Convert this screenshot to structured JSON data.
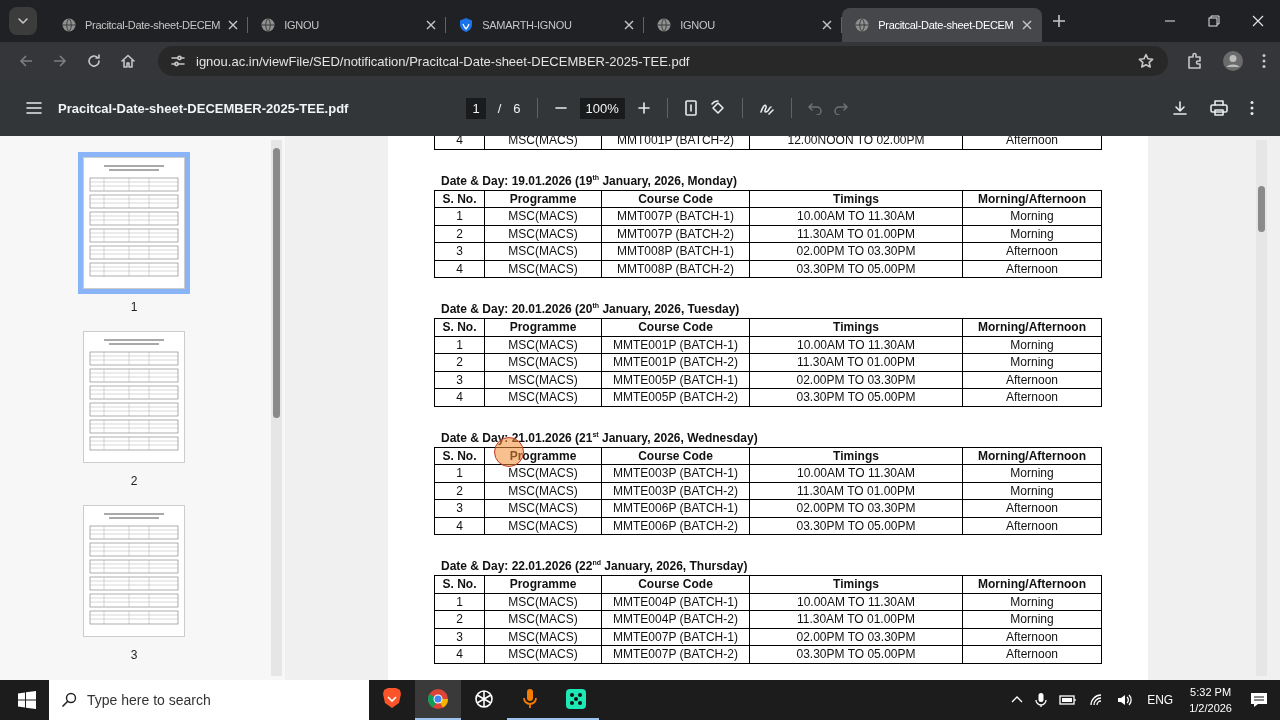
{
  "browser": {
    "tabs": [
      {
        "title": "Pracitcal-Date-sheet-DECEM",
        "kind": "globe",
        "selected": false
      },
      {
        "title": "IGNOU",
        "kind": "globe",
        "selected": false
      },
      {
        "title": "SAMARTH-IGNOU",
        "kind": "shield",
        "selected": false
      },
      {
        "title": "IGNOU",
        "kind": "globe",
        "selected": false
      },
      {
        "title": "Pracitcal-Date-sheet-DECEM",
        "kind": "globe",
        "selected": true
      }
    ],
    "url": "ignou.ac.in/viewFile/SED/notification/Pracitcal-Date-sheet-DECEMBER-2025-TEE.pdf"
  },
  "pdf_toolbar": {
    "file_name": "Pracitcal-Date-sheet-DECEMBER-2025-TEE.pdf",
    "page": "1",
    "page_separator": "/",
    "page_count": "6",
    "zoom": "100%"
  },
  "thumbnails": [
    {
      "label": "1",
      "selected": true
    },
    {
      "label": "2",
      "selected": false
    },
    {
      "label": "3",
      "selected": false
    }
  ],
  "document": {
    "partial_row": [
      "4",
      "MSC(MACS)",
      "MMT001P (BATCH-2)",
      "12.00NOON TO 02.00PM",
      "Afternoon"
    ],
    "sections": [
      {
        "heading": "Date & Day: 19.01.2026 (19$^{th}$ January, 2026, Monday)",
        "columns": [
          "S. No.",
          "Programme",
          "Course Code",
          "Timings",
          "Morning/Afternoon"
        ],
        "rows": [
          [
            "1",
            "MSC(MACS)",
            "MMT007P (BATCH-1)",
            "10.00AM TO 11.30AM",
            "Morning"
          ],
          [
            "2",
            "MSC(MACS)",
            "MMT007P (BATCH-2)",
            "11.30AM TO 01.00PM",
            "Morning"
          ],
          [
            "3",
            "MSC(MACS)",
            "MMT008P (BATCH-1)",
            "02.00PM TO 03.30PM",
            "Afternoon"
          ],
          [
            "4",
            "MSC(MACS)",
            "MMT008P (BATCH-2)",
            "03.30PM TO 05.00PM",
            "Afternoon"
          ]
        ]
      },
      {
        "heading": "Date & Day: 20.01.2026 (20$^{th}$ January, 2026, Tuesday)",
        "columns": [
          "S. No.",
          "Programme",
          "Course Code",
          "Timings",
          "Morning/Afternoon"
        ],
        "rows": [
          [
            "1",
            "MSC(MACS)",
            "MMTE001P (BATCH-1)",
            "10.00AM TO 11.30AM",
            "Morning"
          ],
          [
            "2",
            "MSC(MACS)",
            "MMTE001P (BATCH-2)",
            "11.30AM TO 01.00PM",
            "Morning"
          ],
          [
            "3",
            "MSC(MACS)",
            "MMTE005P (BATCH-1)",
            "02.00PM TO 03.30PM",
            "Afternoon"
          ],
          [
            "4",
            "MSC(MACS)",
            "MMTE005P (BATCH-2)",
            "03.30PM TO 05.00PM",
            "Afternoon"
          ]
        ]
      },
      {
        "heading": "Date & Day: 21.01.2026 (21$^{st}$ January, 2026, Wednesday)",
        "columns": [
          "S. No.",
          "Programme",
          "Course Code",
          "Timings",
          "Morning/Afternoon"
        ],
        "rows": [
          [
            "1",
            "MSC(MACS)",
            "MMTE003P (BATCH-1)",
            "10.00AM TO 11.30AM",
            "Morning"
          ],
          [
            "2",
            "MSC(MACS)",
            "MMTE003P (BATCH-2)",
            "11.30AM TO 01.00PM",
            "Morning"
          ],
          [
            "3",
            "MSC(MACS)",
            "MMTE006P (BATCH-1)",
            "02.00PM TO 03.30PM",
            "Afternoon"
          ],
          [
            "4",
            "MSC(MACS)",
            "MMTE006P (BATCH-2)",
            "03.30PM TO 05.00PM",
            "Afternoon"
          ]
        ]
      },
      {
        "heading": "Date & Day: 22.01.2026 (22$^{nd}$ January, 2026, Thursday)",
        "columns": [
          "S. No.",
          "Programme",
          "Course Code",
          "Timings",
          "Morning/Afternoon"
        ],
        "rows": [
          [
            "1",
            "MSC(MACS)",
            "MMTE004P (BATCH-1)",
            "10.00AM TO 11.30AM",
            "Morning"
          ],
          [
            "2",
            "MSC(MACS)",
            "MMTE004P (BATCH-2)",
            "11.30AM TO 01.00PM",
            "Morning"
          ],
          [
            "3",
            "MSC(MACS)",
            "MMTE007P (BATCH-1)",
            "02.00PM TO 03.30PM",
            "Afternoon"
          ],
          [
            "4",
            "MSC(MACS)",
            "MMTE007P (BATCH-2)",
            "03.30PM TO 05.00PM",
            "Afternoon"
          ]
        ]
      }
    ]
  },
  "taskbar": {
    "search_placeholder": "Type here to search",
    "apps": [
      {
        "kind": "brave",
        "selected": false,
        "running": false
      },
      {
        "kind": "chrome",
        "selected": true,
        "running": true
      },
      {
        "kind": "chatgpt",
        "selected": false,
        "running": false
      },
      {
        "kind": "mic",
        "selected": false,
        "running": true
      },
      {
        "kind": "green",
        "selected": false,
        "running": true
      }
    ],
    "language": "ENG",
    "time": "5:32 PM",
    "date": "1/2/2026"
  }
}
